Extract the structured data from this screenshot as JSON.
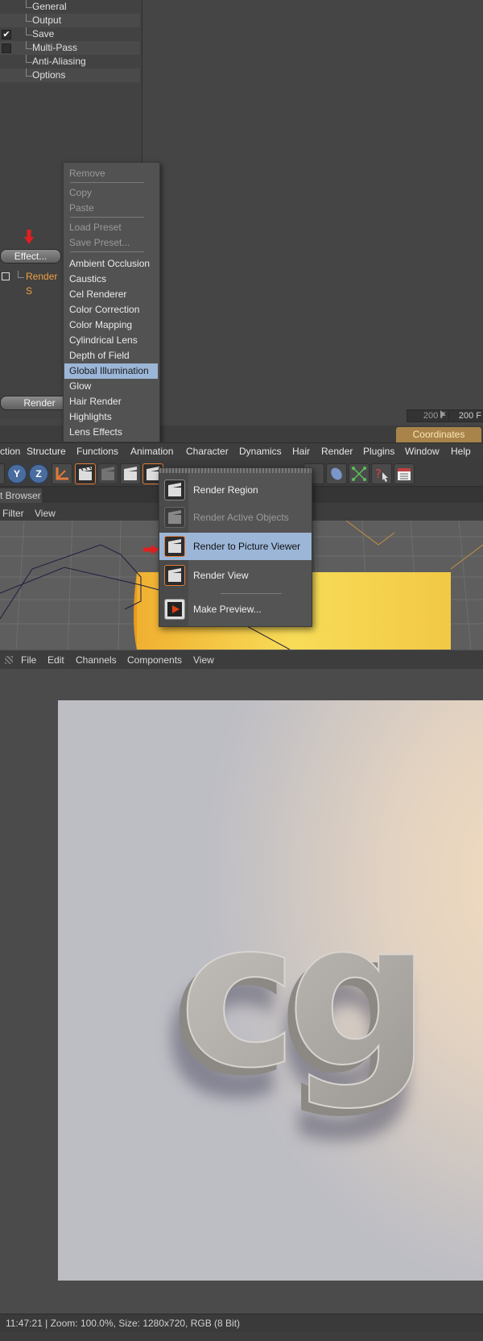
{
  "render_settings": {
    "tree": [
      {
        "label": "General",
        "checked": null
      },
      {
        "label": "Output",
        "checked": null
      },
      {
        "label": "Save",
        "checked": true
      },
      {
        "label": "Multi-Pass",
        "checked": false
      },
      {
        "label": "Anti-Aliasing",
        "checked": null
      },
      {
        "label": "Options",
        "checked": null
      }
    ],
    "effect_button": "Effect...",
    "render_setting_item": "Render S",
    "render_button": "Render",
    "timeline_fields": [
      "200 F",
      "200 F"
    ],
    "coordinates_tab": "Coordinates",
    "accent_color": "#f0a040"
  },
  "effect_menu": {
    "items": [
      {
        "label": "Remove",
        "disabled": true,
        "selected": false,
        "sep_after": true
      },
      {
        "label": "Copy",
        "disabled": true,
        "selected": false,
        "sep_after": false
      },
      {
        "label": "Paste",
        "disabled": true,
        "selected": false,
        "sep_after": true
      },
      {
        "label": "Load Preset",
        "disabled": true,
        "selected": false,
        "sep_after": false
      },
      {
        "label": "Save Preset...",
        "disabled": true,
        "selected": false,
        "sep_after": true
      },
      {
        "label": "Ambient Occlusion",
        "disabled": false,
        "selected": false
      },
      {
        "label": "Caustics",
        "disabled": false,
        "selected": false
      },
      {
        "label": "Cel Renderer",
        "disabled": false,
        "selected": false
      },
      {
        "label": "Color Correction",
        "disabled": false,
        "selected": false
      },
      {
        "label": "Color Mapping",
        "disabled": false,
        "selected": false
      },
      {
        "label": "Cylindrical Lens",
        "disabled": false,
        "selected": false
      },
      {
        "label": "Depth of Field",
        "disabled": false,
        "selected": false
      },
      {
        "label": "Global Illumination",
        "disabled": false,
        "selected": true
      },
      {
        "label": "Glow",
        "disabled": false,
        "selected": false
      },
      {
        "label": "Hair Render",
        "disabled": false,
        "selected": false
      },
      {
        "label": "Highlights",
        "disabled": false,
        "selected": false
      },
      {
        "label": "Lens Effects",
        "disabled": false,
        "selected": false
      }
    ],
    "highlight_color": "#9cb6d8"
  },
  "main_menu": [
    "ction",
    "Structure",
    "Functions",
    "Animation",
    "Character",
    "Dynamics",
    "Hair",
    "Render",
    "Plugins",
    "Window",
    "Help"
  ],
  "toolbar": {
    "axis_buttons": [
      "Y",
      "Z"
    ]
  },
  "browser": {
    "tab": "t Browser",
    "menu": [
      "Filter",
      "View"
    ]
  },
  "render_menu": {
    "items": [
      {
        "label": "Render Region",
        "disabled": false,
        "selected": false,
        "icon": "clapper-icon"
      },
      {
        "label": "Render Active Objects",
        "disabled": true,
        "selected": false,
        "icon": "clapper-icon"
      },
      {
        "label": "Render to Picture Viewer",
        "disabled": false,
        "selected": true,
        "icon": "clapper-icon"
      },
      {
        "label": "Render View",
        "disabled": false,
        "selected": false,
        "icon": "clapper-icon"
      },
      {
        "label": "Make Preview...",
        "disabled": false,
        "selected": false,
        "icon": "play-icon"
      }
    ]
  },
  "picture_viewer": {
    "menu": [
      "File",
      "Edit",
      "Channels",
      "Components",
      "View"
    ],
    "image_text": "cg",
    "status": "11:47:21 | Zoom: 100.0%, Size: 1280x720, RGB (8 Bit)"
  }
}
